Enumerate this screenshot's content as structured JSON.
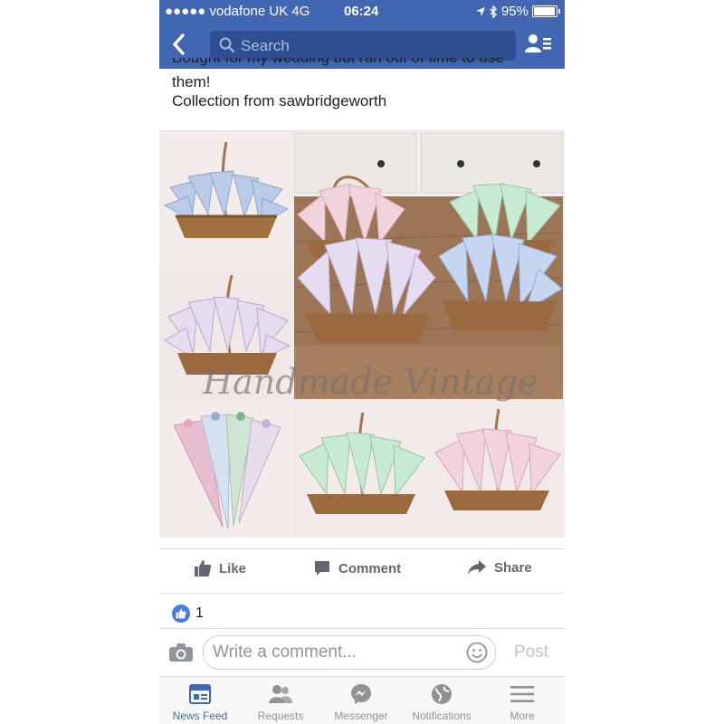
{
  "status_bar": {
    "carrier": "●●●●● vodafone UK  4G",
    "time": "06:24",
    "battery": "95%"
  },
  "nav": {
    "search_placeholder": "Search",
    "icons": [
      "back-chevron-icon",
      "search-icon",
      "friends-list-icon"
    ]
  },
  "post": {
    "text_line_clipped": "Bought for my wedding but ran out of time to use",
    "text_line_1": "them!",
    "text_line_2": "Collection from sawbridgeworth",
    "photo_watermark": "Handmade Vintage"
  },
  "actions": {
    "like": "Like",
    "comment": "Comment",
    "share": "Share"
  },
  "reactions": {
    "count": "1"
  },
  "comment_bar": {
    "placeholder": "Write a comment...",
    "post_label": "Post"
  },
  "tabbar": {
    "tabs": [
      {
        "label": "News Feed",
        "icon": "news-feed-icon",
        "active": true
      },
      {
        "label": "Requests",
        "icon": "requests-icon",
        "active": false
      },
      {
        "label": "Messenger",
        "icon": "messenger-icon",
        "active": false
      },
      {
        "label": "Notifications",
        "icon": "globe-icon",
        "active": false
      },
      {
        "label": "More",
        "icon": "hamburger-icon",
        "active": false
      }
    ]
  },
  "colors": {
    "brand": "#4267b2",
    "search_bg": "#2e4f91",
    "text": "#1d2129",
    "muted": "#606770",
    "inactive_tab": "#929292"
  }
}
